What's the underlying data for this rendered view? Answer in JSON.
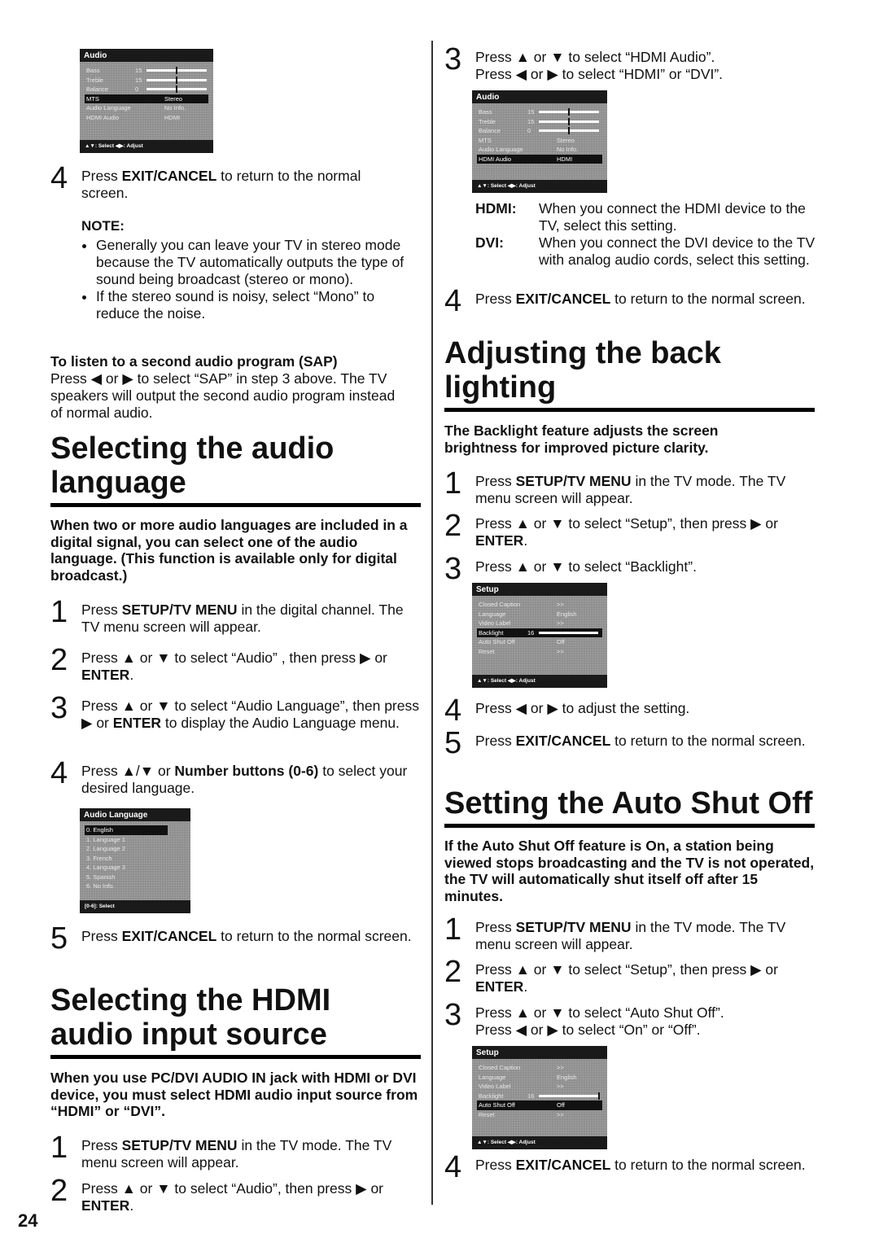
{
  "page_number": "24",
  "left": {
    "menu_audio_mts": {
      "title": "Audio",
      "rows": [
        {
          "label": "Bass",
          "value": "15",
          "type": "slider",
          "level": 0.5
        },
        {
          "label": "Treble",
          "value": "15",
          "type": "slider",
          "level": 0.5
        },
        {
          "label": "Balance",
          "value": "0",
          "type": "slider",
          "level": 0.5
        },
        {
          "label": "MTS",
          "value": "Stereo",
          "selected": true
        },
        {
          "label": "Audio Language",
          "value": "No Info."
        },
        {
          "label": "HDMI Audio",
          "value": "HDMI"
        }
      ],
      "footer": "▲▼: Select  ◀▶: Adjust"
    },
    "step4": {
      "num": "4",
      "pre": "Press ",
      "bold": "EXIT/CANCEL",
      "post": " to return to the normal screen."
    },
    "note": {
      "heading": "NOTE:",
      "bullets": [
        "Generally you can leave your TV in stereo mode because the TV automatically outputs the type of sound being broadcast (stereo or mono).",
        "If the stereo sound is noisy, select “Mono” to reduce the noise."
      ]
    },
    "sap": {
      "heading": "To listen to a second audio program (SAP)",
      "text": "Press ◀ or ▶ to select “SAP” in step 3 above. The TV speakers will output the second audio program instead of normal audio."
    },
    "section_audio_language": {
      "title": "Selecting the audio language",
      "lead": "When two or more audio languages are included in a digital signal, you can select one of the audio language. (This function is available only for digital broadcast.)",
      "steps": [
        {
          "num": "1",
          "html": "Press <b>SETUP/TV MENU</b> in the digital channel. The TV menu screen will appear."
        },
        {
          "num": "2",
          "html": "Press ▲ or ▼ to select “Audio” , then press ▶ or <b>ENTER</b>."
        },
        {
          "num": "3",
          "html": "Press ▲ or ▼ to select “Audio Language”, then press ▶ or <b>ENTER</b> to display the Audio Language menu."
        },
        {
          "num": "4",
          "html": "Press ▲/▼ or <b>Number buttons (0-6)</b> to select your desired language."
        }
      ],
      "menu": {
        "title": "Audio Language",
        "rows": [
          "0. English",
          "1. Language 1",
          "2. Language 2",
          "3. French",
          "4. Language 3",
          "5. Spanish",
          "6. No Info."
        ],
        "selected_index": 0,
        "footer": "[0-6]: Select"
      },
      "step5": {
        "num": "5",
        "html": "Press <b>EXIT/CANCEL</b> to return to the normal screen."
      }
    },
    "section_hdmi": {
      "title": "Selecting the HDMI audio input source",
      "lead": "When you use PC/DVI AUDIO IN jack with HDMI or DVI device, you must select HDMI audio input source from “HDMI” or “DVI”.",
      "steps": [
        {
          "num": "1",
          "html": "Press <b>SETUP/TV MENU</b> in the TV mode. The TV menu screen will appear."
        },
        {
          "num": "2",
          "html": "Press ▲ or ▼ to select “Audio”, then press ▶ or <b>ENTER</b>."
        }
      ]
    }
  },
  "right": {
    "hdmi_step3": {
      "num": "3",
      "html": "Press ▲ or ▼ to select “HDMI Audio”.<br>Press ◀ or ▶ to select “HDMI” or “DVI”."
    },
    "menu_audio_hdmi": {
      "title": "Audio",
      "rows": [
        {
          "label": "Bass",
          "value": "15",
          "type": "slider",
          "level": 0.5
        },
        {
          "label": "Treble",
          "value": "15",
          "type": "slider",
          "level": 0.5
        },
        {
          "label": "Balance",
          "value": "0",
          "type": "slider",
          "level": 0.5
        },
        {
          "label": "MTS",
          "value": "Stereo"
        },
        {
          "label": "Audio Language",
          "value": "No Info."
        },
        {
          "label": "HDMI Audio",
          "value": "HDMI",
          "selected": true
        }
      ],
      "footer": "▲▼: Select  ◀▶: Adjust"
    },
    "terms": [
      {
        "term": "HDMI:",
        "desc": "When you connect the HDMI device to the TV, select this setting."
      },
      {
        "term": "DVI:",
        "desc": "When you connect the DVI device to the TV with analog audio cords, select this setting."
      }
    ],
    "hdmi_step4": {
      "num": "4",
      "html": "Press <b>EXIT/CANCEL</b> to return to the normal screen."
    },
    "section_backlight": {
      "title": "Adjusting the back lighting",
      "lead": "The Backlight feature adjusts the screen brightness for improved picture clarity.",
      "steps": [
        {
          "num": "1",
          "html": "Press <b>SETUP/TV MENU</b> in the TV mode. The TV menu screen will appear."
        },
        {
          "num": "2",
          "html": "Press ▲ or ▼ to select “Setup”, then press ▶ or <b>ENTER</b>."
        },
        {
          "num": "3",
          "html": "Press ▲ or ▼ to select “Backlight”."
        }
      ],
      "menu": {
        "title": "Setup",
        "rows": [
          {
            "label": "Closed Caption",
            "value": ">>"
          },
          {
            "label": "Language",
            "value": "English"
          },
          {
            "label": "Video Label",
            "value": ">>"
          },
          {
            "label": "Backlight",
            "value": "16",
            "type": "slider",
            "level": 1.0,
            "selected": true
          },
          {
            "label": "Auto Shut Off",
            "value": "Off"
          },
          {
            "label": "Reset",
            "value": ">>"
          }
        ],
        "footer": "▲▼: Select  ◀▶: Adjust"
      },
      "steps_after": [
        {
          "num": "4",
          "html": "Press ◀ or ▶ to adjust the setting."
        },
        {
          "num": "5",
          "html": "Press <b>EXIT/CANCEL</b> to return to the normal screen."
        }
      ]
    },
    "section_autoshutoff": {
      "title": "Setting the Auto Shut Off",
      "lead": "If the Auto Shut Off feature is On, a station being viewed stops broadcasting and the TV is not operated, the TV will automatically shut itself off after 15 minutes.",
      "steps": [
        {
          "num": "1",
          "html": "Press <b>SETUP/TV MENU</b> in the TV mode. The TV menu screen will appear."
        },
        {
          "num": "2",
          "html": "Press ▲ or ▼ to select “Setup”, then press ▶ or <b>ENTER</b>."
        },
        {
          "num": "3",
          "html": "Press ▲ or ▼ to select “Auto Shut Off”.<br>Press ◀ or ▶ to select “On” or “Off”."
        }
      ],
      "menu": {
        "title": "Setup",
        "rows": [
          {
            "label": "Closed Caption",
            "value": ">>"
          },
          {
            "label": "Language",
            "value": "English"
          },
          {
            "label": "Video Label",
            "value": ">>"
          },
          {
            "label": "Backlight",
            "value": "16",
            "type": "slider",
            "level": 1.0
          },
          {
            "label": "Auto Shut Off",
            "value": "Off",
            "selected": true
          },
          {
            "label": "Reset",
            "value": ">>"
          }
        ],
        "footer": "▲▼: Select  ◀▶: Adjust"
      },
      "step4": {
        "num": "4",
        "html": "Press <b>EXIT/CANCEL</b> to return to the normal screen."
      }
    }
  }
}
